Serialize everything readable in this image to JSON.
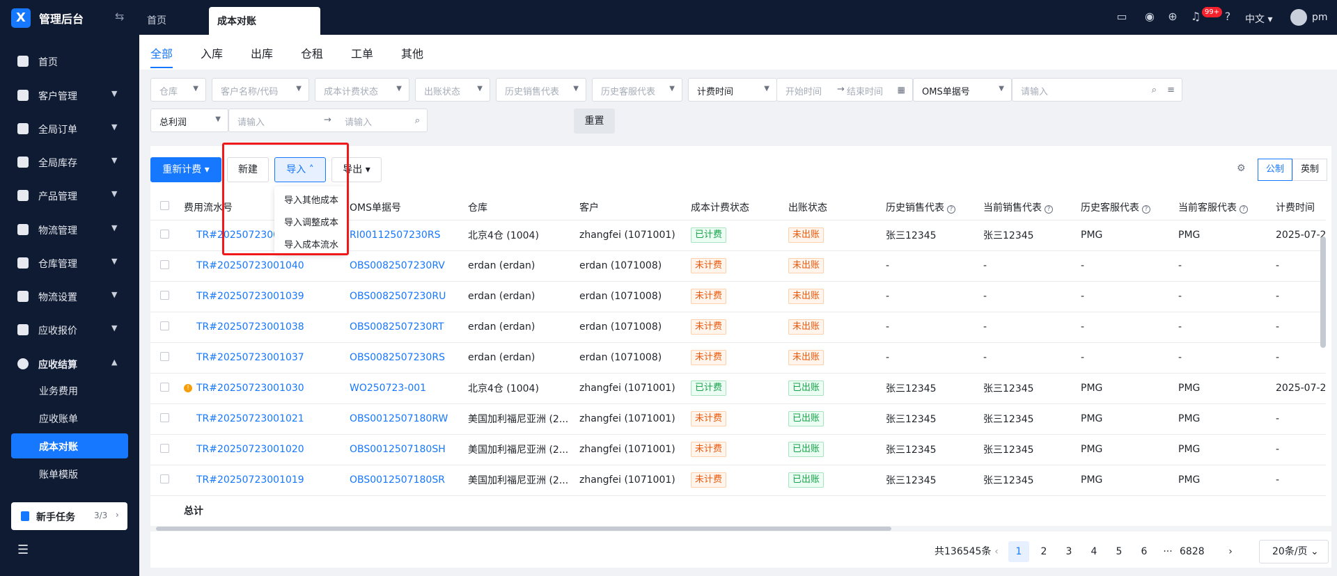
{
  "topbar": {
    "logo": "X",
    "brand": "管理后台",
    "home_tab": "首页",
    "active_tab": "成本对账",
    "notify_badge": "99+",
    "language": "中文",
    "user": "pm"
  },
  "sidebar": {
    "items": [
      {
        "label": "首页",
        "icon": "home-icon"
      },
      {
        "label": "客户管理",
        "icon": "users-icon"
      },
      {
        "label": "全局订单",
        "icon": "order-icon"
      },
      {
        "label": "全局库存",
        "icon": "inventory-icon"
      },
      {
        "label": "产品管理",
        "icon": "product-icon"
      },
      {
        "label": "物流管理",
        "icon": "truck-icon"
      },
      {
        "label": "仓库管理",
        "icon": "warehouse-icon"
      },
      {
        "label": "物流设置",
        "icon": "settings-icon"
      },
      {
        "label": "应收报价",
        "icon": "quote-icon"
      },
      {
        "label": "应收结算",
        "icon": "dollar-icon"
      }
    ],
    "sub_items": [
      "业务费用",
      "应收账单",
      "成本对账",
      "账单模版"
    ],
    "task": {
      "label": "新手任务",
      "progress": "3/3"
    }
  },
  "filter_tabs": [
    "全部",
    "入库",
    "出库",
    "仓租",
    "工单",
    "其他"
  ],
  "filters": {
    "warehouse": "仓库",
    "customer": "客户名称/代码",
    "cost_status": "成本计费状态",
    "out_status": "出账状态",
    "hist_sales": "历史销售代表",
    "hist_service": "历史客服代表",
    "time_type": "计费时间",
    "start_time": "开始时间",
    "end_time": "结束时间",
    "oms_type": "OMS单据号",
    "oms_input": "请输入",
    "profit_type": "总利润",
    "profit_min": "请输入",
    "profit_max": "请输入",
    "reset": "重置"
  },
  "toolbar": {
    "recalc": "重新计费",
    "new": "新建",
    "import": "导入",
    "export": "导出",
    "metric": "公制",
    "imperial": "英制"
  },
  "import_menu": [
    "导入其他成本",
    "导入调整成本",
    "导入成本流水"
  ],
  "table": {
    "headers": [
      "费用流水号",
      "OMS单据号",
      "仓库",
      "客户",
      "成本计费状态",
      "出账状态",
      "历史销售代表",
      "当前销售代表",
      "历史客服代表",
      "当前客服代表",
      "计费时间"
    ],
    "rows": [
      [
        "TR#20250723001041",
        "RI00112507230RS",
        "北京4仓 (1004)",
        "zhangfei (1071001)",
        "已计费",
        "未出账",
        "张三12345",
        "张三12345",
        "PMG",
        "PMG",
        "2025-07-2"
      ],
      [
        "TR#20250723001040",
        "OBS0082507230RV",
        "erdan (erdan)",
        "erdan (1071008)",
        "未计费",
        "未出账",
        "-",
        "-",
        "-",
        "-",
        "-"
      ],
      [
        "TR#20250723001039",
        "OBS0082507230RU",
        "erdan (erdan)",
        "erdan (1071008)",
        "未计费",
        "未出账",
        "-",
        "-",
        "-",
        "-",
        "-"
      ],
      [
        "TR#20250723001038",
        "OBS0082507230RT",
        "erdan (erdan)",
        "erdan (1071008)",
        "未计费",
        "未出账",
        "-",
        "-",
        "-",
        "-",
        "-"
      ],
      [
        "TR#20250723001037",
        "OBS0082507230RS",
        "erdan (erdan)",
        "erdan (1071008)",
        "未计费",
        "未出账",
        "-",
        "-",
        "-",
        "-",
        "-"
      ],
      [
        "TR#20250723001030",
        "WO250723-001",
        "北京4仓 (1004)",
        "zhangfei (1071001)",
        "已计费",
        "已出账",
        "张三12345",
        "张三12345",
        "PMG",
        "PMG",
        "2025-07-2"
      ],
      [
        "TR#20250723001021",
        "OBS0012507180RW",
        "美国加利福尼亚洲 (2...",
        "zhangfei (1071001)",
        "未计费",
        "已出账",
        "张三12345",
        "张三12345",
        "PMG",
        "PMG",
        "-"
      ],
      [
        "TR#20250723001020",
        "OBS0012507180SH",
        "美国加利福尼亚洲 (2...",
        "zhangfei (1071001)",
        "未计费",
        "已出账",
        "张三12345",
        "张三12345",
        "PMG",
        "PMG",
        "-"
      ],
      [
        "TR#20250723001019",
        "OBS0012507180SR",
        "美国加利福尼亚洲 (2...",
        "zhangfei (1071001)",
        "未计费",
        "已出账",
        "张三12345",
        "张三12345",
        "PMG",
        "PMG",
        "-"
      ]
    ],
    "total_label": "总计"
  },
  "pagination": {
    "total": "共136545条",
    "pages": [
      "1",
      "2",
      "3",
      "4",
      "5",
      "6"
    ],
    "ellipsis": "···",
    "last": "6828",
    "page_size": "20条/页"
  },
  "colors": {
    "primary": "#1677ff",
    "sidebar": "#0f1b33",
    "highlight_box": "#f01818"
  }
}
